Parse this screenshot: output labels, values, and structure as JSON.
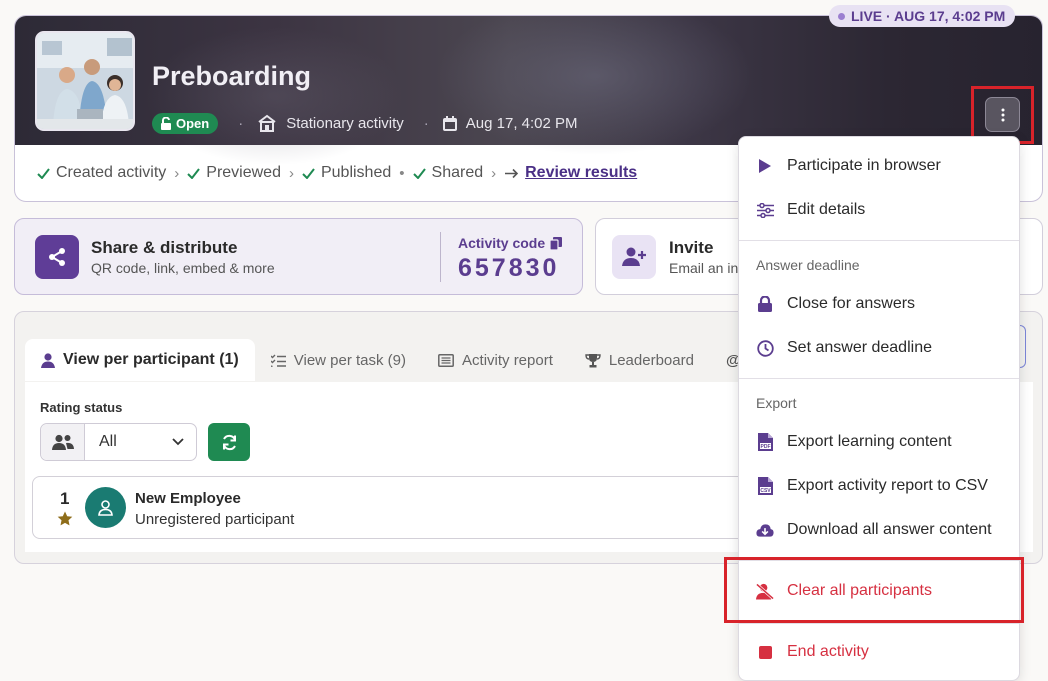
{
  "header": {
    "live_label": "LIVE · AUG 17, 4:02 PM",
    "title": "Preboarding",
    "status_badge": "Open",
    "activity_type": "Stationary activity",
    "date": "Aug 17, 4:02 PM"
  },
  "progress_steps": {
    "created": "Created activity",
    "previewed": "Previewed",
    "published": "Published",
    "shared": "Shared",
    "review": "Review results"
  },
  "share": {
    "title": "Share & distribute",
    "subtitle": "QR code, link, embed & more",
    "code_label": "Activity code",
    "code_value": "657830"
  },
  "invite": {
    "title": "Invite",
    "subtitle": "Email an in"
  },
  "tabs": [
    {
      "label": "View per participant (1)"
    },
    {
      "label": "View per task (9)"
    },
    {
      "label": "Activity report"
    },
    {
      "label": "Leaderboard"
    }
  ],
  "filters": {
    "rating_label": "Rating status",
    "rating_value": "All"
  },
  "participant": {
    "rank": "1",
    "name": "New Employee",
    "status": "Unregistered participant"
  },
  "menu": {
    "participate": "Participate in browser",
    "edit": "Edit details",
    "deadline_header": "Answer deadline",
    "close_answers": "Close for answers",
    "set_deadline": "Set answer deadline",
    "export_header": "Export",
    "export_learning": "Export learning content",
    "export_csv": "Export activity report to CSV",
    "download_all": "Download all answer content",
    "clear_participants": "Clear all participants",
    "end_activity": "End activity"
  },
  "colors": {
    "brand_purple": "#5b3d8f",
    "success_green": "#1f8a52",
    "danger_red": "#d63041",
    "highlight_red": "#d8232a"
  }
}
